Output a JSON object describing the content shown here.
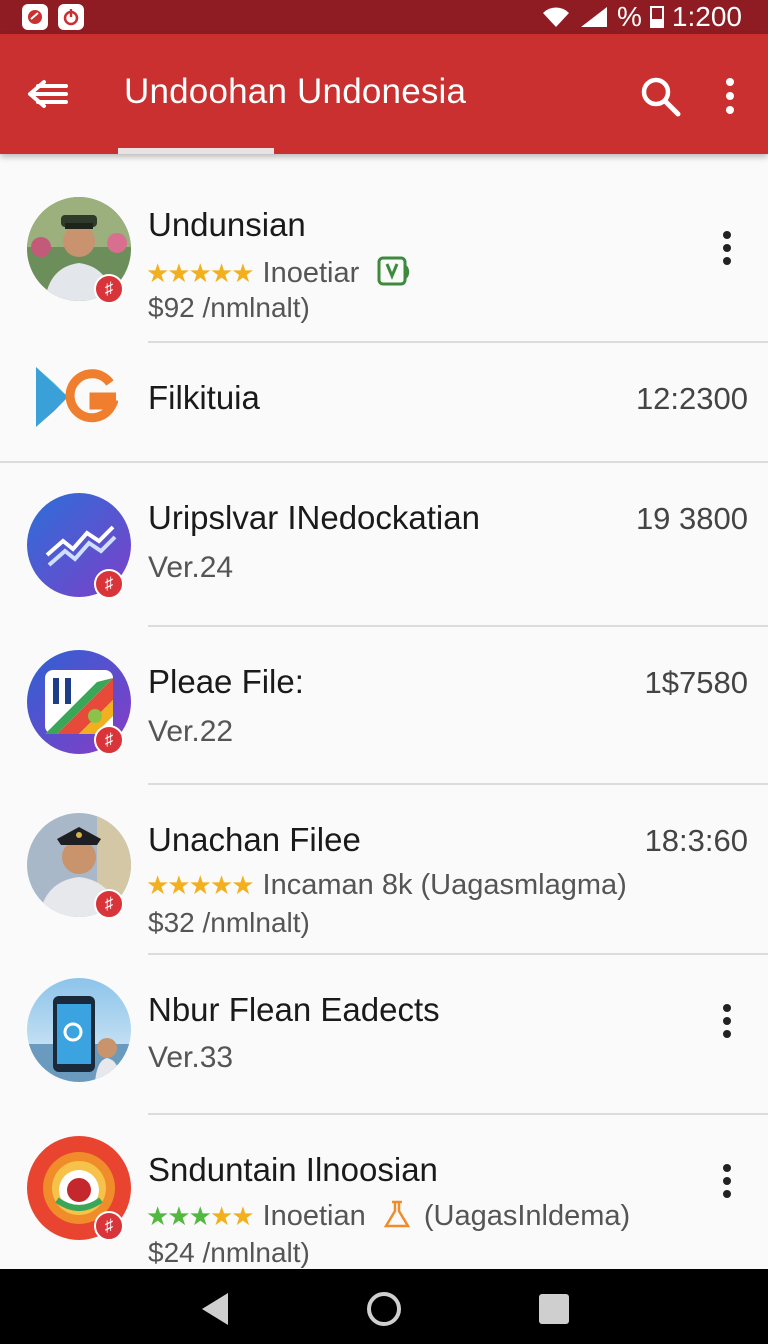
{
  "status_bar": {
    "icons": [
      "app-notification-icon",
      "power-notification-icon",
      "wifi-icon",
      "signal-icon",
      "battery-icon"
    ],
    "percent": "%",
    "time": "1:200"
  },
  "app_bar": {
    "title": "Undoohan Undonesia",
    "icons": [
      "back-arrow-icon",
      "search-icon",
      "overflow-menu-icon"
    ],
    "color": "#c9302f"
  },
  "list": [
    {
      "title": "Undunsian",
      "rating_text": "Inoetiar",
      "price": "$92 /nmlnalt)",
      "stars": 5,
      "icon": "officer-photo"
    },
    {
      "title": "Filkituia",
      "meta": "12:2300",
      "icon": "play-g-logo-icon"
    },
    {
      "title": "Uripslvar INedockatian",
      "sub": "Ver.24",
      "meta": "19 3800",
      "icon": "chart-app-icon"
    },
    {
      "title": "Pleae File:",
      "sub": "Ver.22",
      "meta": "1$7580",
      "icon": "stripes-app-icon"
    },
    {
      "title": "Unachan Filee",
      "rating_text": "Incaman 8k (Uagasmlagma)",
      "price": "$32 /nmlnalt)",
      "meta": "18:3:60",
      "stars": 5,
      "icon": "officer-photo"
    },
    {
      "title": "Nbur Flean Eadects",
      "sub": "Ver.33",
      "icon": "phone-app-icon"
    },
    {
      "title": "Snduntain Ilnoosian",
      "rating_text": "Inoetian",
      "rating_suffix": "(UagasInldema)",
      "price": "$24 /nmlnalt)",
      "stars": 5,
      "icon": "ring-app-icon"
    }
  ],
  "badge_glyph": "♯",
  "star_glyphs": "★★★★★",
  "nav_bar": {
    "icons": [
      "back-triangle-icon",
      "home-circle-icon",
      "recents-square-icon"
    ]
  }
}
